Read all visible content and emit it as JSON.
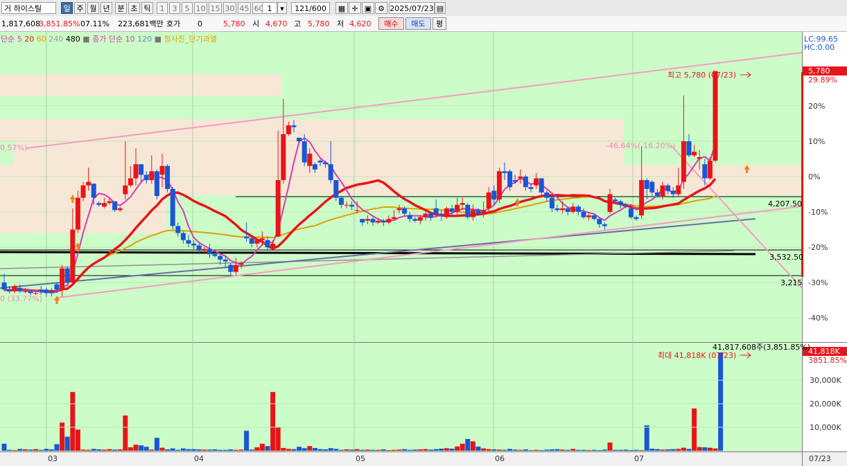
{
  "toolbar": {
    "stock_name": "거 하이스틸",
    "period_tabs": [
      "일",
      "주",
      "월",
      "년",
      "분",
      "초",
      "틱"
    ],
    "selected_period": "일",
    "intervals": [
      "1",
      "3",
      "5",
      "10",
      "15",
      "30",
      "45",
      "60"
    ],
    "interval_value": "1",
    "count_value": "121",
    "count_total": "/600",
    "date_value": "2025/07/23"
  },
  "info_bar": {
    "volume": "1,817,608",
    "volume_ratio": "3,851.85%",
    "turnover": "07.11%",
    "amount": "223,681백만",
    "quote_label": "호가",
    "quote_value": "0",
    "current_price": "5,780",
    "open_label": "시",
    "open_value": "4,670",
    "high_label": "고",
    "high_value": "5,780",
    "low_label": "저",
    "low_value": "4,620",
    "buy_button": "매수",
    "sell_button": "매도",
    "eval_button": "평"
  },
  "legend": {
    "price_ma_label": "단순",
    "price_ma_periods": [
      "5",
      "20",
      "60",
      "240",
      "480"
    ],
    "price_ma_colors": [
      "#e8141a",
      "#e8141a",
      "#e0a000",
      "#9a9a9a",
      "#000000"
    ],
    "volume_ma_label": "종가 단순",
    "volume_ma_periods": [
      "10",
      "120"
    ],
    "signal_label": "청사진_단기과열",
    "lc_label": "LC:99.65",
    "hc_label": "HC:0.00"
  },
  "annotations": {
    "high_marker": "최고 5,780 (07/23)",
    "max_volume_marker": "최대 41,818K (07/23)",
    "decline_label": "-46.64%(-16.20%)",
    "left_pct_label": "0.57%)",
    "bottom_left_label": "0 (33.77%)",
    "volume_total_label": "41,817,608주(3,851.85%)"
  },
  "price_axis": {
    "current_box": "5,780",
    "current_pct": "29.89%",
    "pct_ticks": [
      "20%",
      "10%",
      "0%",
      "-10%",
      "-20%",
      "-30%",
      "-40%"
    ],
    "level_labels": [
      "4,207.50",
      "3,532.50",
      "3,215"
    ]
  },
  "volume_axis": {
    "current_box": "41,818K",
    "current_pct": "3851.85%",
    "ticks": [
      "30,000K",
      "20,000K",
      "10,000K"
    ]
  },
  "x_axis": {
    "month_labels": [
      "03",
      "04",
      "05",
      "06",
      "07"
    ],
    "end_label": "07/23"
  },
  "colors": {
    "chart_bg": "#ccfcc8",
    "up_candle": "#e8141a",
    "down_candle": "#1a56d6",
    "ma5": "#d63ab4",
    "ma20": "#e8141a",
    "ma60": "#e0a000",
    "channel": "#f79ac0",
    "resistance_zone": "#f7e7d6"
  },
  "chart_data": {
    "type": "candlestick",
    "period": "daily",
    "months_shown": [
      "03",
      "04",
      "05",
      "06",
      "07"
    ],
    "last_date": "2025/07/23",
    "last_candle": {
      "open": 4670,
      "high": 5780,
      "low": 4620,
      "close": 5780
    },
    "highest": {
      "price": 5780,
      "date": "07/23"
    },
    "support_levels": [
      4207.5,
      3532.5,
      3215
    ],
    "candles_pct": [
      [
        -30,
        -32,
        -32.5,
        -27.5
      ],
      [
        -32,
        -32.5,
        -33,
        -31
      ],
      [
        -32.5,
        -31,
        -33,
        -30.5
      ],
      [
        -31.5,
        -32.5,
        -33,
        -30.5
      ],
      [
        -32.5,
        -32.5,
        -33,
        -31.5
      ],
      [
        -32.5,
        -33,
        -33.5,
        -32
      ],
      [
        -33,
        -33,
        -33.5,
        -32.5
      ],
      [
        -32,
        -32.5,
        -33.5,
        -31
      ],
      [
        -32,
        -33,
        -34,
        -31.5
      ],
      [
        -32.5,
        -33,
        -34,
        -31.5
      ],
      [
        -30.5,
        -32,
        -33,
        -30
      ],
      [
        -32,
        -26,
        -34,
        -25
      ],
      [
        -26,
        -30,
        -31,
        -25.5
      ],
      [
        -30,
        -15,
        -31,
        -9
      ],
      [
        -15,
        -6,
        -16,
        -4
      ],
      [
        -6,
        -2.5,
        -7,
        -1.5
      ],
      [
        -2.5,
        -1.5,
        -4,
        2.5
      ],
      [
        -2,
        -6,
        -8,
        -2
      ],
      [
        -7.5,
        -8,
        -8.5,
        -7
      ],
      [
        -8.5,
        -7.5,
        -9,
        -6
      ],
      [
        -7.5,
        -7,
        -8,
        -6
      ],
      [
        -7,
        -9.5,
        -10,
        -7
      ],
      [
        -9.5,
        -9,
        -10,
        -8.5
      ],
      [
        -5,
        -2.5,
        -6.5,
        10
      ],
      [
        -2.5,
        -0.5,
        -3,
        3
      ],
      [
        -0.5,
        3.5,
        -2.5,
        8
      ],
      [
        3.5,
        0.5,
        -1.5,
        2.5
      ],
      [
        0.5,
        -1,
        -2,
        1.5
      ],
      [
        -1,
        1.5,
        -2,
        6
      ],
      [
        1.5,
        -5.5,
        -6.5,
        2
      ],
      [
        0.5,
        3,
        -3,
        6.5
      ],
      [
        3,
        -3.5,
        -4.5,
        3.5
      ],
      [
        -3.5,
        -14,
        -15,
        -3
      ],
      [
        -14,
        -16,
        -17,
        -13
      ],
      [
        -16,
        -18,
        -19,
        -15.5
      ],
      [
        -18,
        -19,
        -20,
        -16.5
      ],
      [
        -19,
        -19.5,
        -20.5,
        -18
      ],
      [
        -19.5,
        -21,
        -22,
        -19
      ],
      [
        -21,
        -20.5,
        -22,
        -20
      ],
      [
        -20.5,
        -22,
        -23,
        -19
      ],
      [
        -22,
        -22.5,
        -23,
        -21
      ],
      [
        -22.5,
        -23.5,
        -25,
        -22
      ],
      [
        -23.5,
        -24,
        -26,
        -22.5
      ],
      [
        -25,
        -27,
        -28,
        -24.5
      ],
      [
        -27,
        -25,
        -28,
        -23
      ],
      [
        -25,
        -24.5,
        -26,
        -24
      ],
      [
        -17,
        -17.5,
        -18.5,
        -13
      ],
      [
        -17.5,
        -19,
        -20,
        -17
      ],
      [
        -19,
        -18,
        -20,
        -17.5
      ],
      [
        -18,
        -17.5,
        -19.5,
        -15.5
      ],
      [
        -18,
        -20,
        -21,
        -17
      ],
      [
        -20,
        -19,
        -21,
        -18
      ],
      [
        -17,
        -1,
        -3,
        13
      ],
      [
        -1,
        12,
        -2,
        22
      ],
      [
        12,
        14.5,
        11.5,
        15.5
      ],
      [
        14.5,
        14,
        12.5,
        16
      ],
      [
        11,
        10,
        9.5,
        11
      ],
      [
        10,
        4,
        3,
        12
      ],
      [
        3,
        6.5,
        1,
        8
      ],
      [
        3.5,
        2,
        1,
        4
      ],
      [
        4.5,
        4,
        3,
        5
      ],
      [
        4,
        3.5,
        2.5,
        4.5
      ],
      [
        3.5,
        -1,
        -2,
        10
      ],
      [
        -1,
        -6,
        -7,
        -2
      ],
      [
        -6,
        -8,
        -9,
        -5.5
      ],
      [
        -8,
        -8,
        -9,
        -7
      ],
      [
        -8,
        -8.5,
        -9.5,
        -7
      ],
      [
        -9.5,
        -9.5,
        -10.5,
        -7
      ],
      [
        -12,
        -13,
        -14,
        -12
      ],
      [
        -12.5,
        -12,
        -13.5,
        -11
      ],
      [
        -12,
        -13,
        -14,
        -11.5
      ],
      [
        -13,
        -12.5,
        -13.5,
        -12
      ],
      [
        -12.5,
        -13,
        -14,
        -12
      ],
      [
        -13,
        -12,
        -13.5,
        -11
      ],
      [
        -12,
        -11.5,
        -12.5,
        -9.5
      ],
      [
        -9.5,
        -9,
        -10.5,
        -8
      ],
      [
        -9,
        -10.5,
        -11,
        -8.5
      ],
      [
        -11,
        -12,
        -13,
        -10
      ],
      [
        -12,
        -12.5,
        -13,
        -11.5
      ],
      [
        -12.5,
        -11.5,
        -13.5,
        -11
      ],
      [
        -11.5,
        -10.5,
        -12.5,
        -10
      ],
      [
        -10.5,
        -11.5,
        -12.5,
        -10
      ],
      [
        -9,
        -10.5,
        -11,
        -6.5
      ],
      [
        -10.5,
        -11,
        -12.5,
        -9.5
      ],
      [
        -11.5,
        -9,
        -12,
        -8.5
      ],
      [
        -9,
        -10,
        -11,
        -8
      ],
      [
        -10,
        -8,
        -11,
        -6
      ],
      [
        -8,
        -7.5,
        -9.5,
        -6
      ],
      [
        -8,
        -11.5,
        -12,
        -7.5
      ],
      [
        -11.5,
        -9.5,
        -12.5,
        -8
      ],
      [
        -9.5,
        -10.5,
        -11,
        -9
      ],
      [
        -10.5,
        -9.5,
        -11.5,
        -7
      ],
      [
        -9,
        -4.5,
        -10,
        -3
      ],
      [
        -4,
        -6.5,
        -8,
        -2.5
      ],
      [
        -6.5,
        1.5,
        -7.5,
        2.5
      ],
      [
        1.5,
        1,
        -1,
        4
      ],
      [
        1.5,
        -3,
        -4,
        2
      ],
      [
        -1,
        -1.5,
        -2,
        0.5
      ],
      [
        -0.5,
        0,
        -2,
        2
      ],
      [
        0,
        -3,
        -4,
        0.5
      ],
      [
        -3,
        -3.5,
        -4.5,
        -2
      ],
      [
        -2.5,
        -0.5,
        -3.5,
        1
      ],
      [
        -0.5,
        -4.5,
        -5.5,
        -0.5
      ],
      [
        -4.5,
        -6,
        -7,
        -4
      ],
      [
        -6,
        -9,
        -10,
        -5.5
      ],
      [
        -9,
        -9.5,
        -10,
        -8
      ],
      [
        -9.5,
        -9,
        -10.5,
        -7
      ],
      [
        -9,
        -10,
        -11,
        -8.5
      ],
      [
        -10,
        -8.5,
        -10.5,
        -7.5
      ],
      [
        -8.5,
        -10,
        -11,
        -8
      ],
      [
        -10,
        -11.5,
        -12,
        -9
      ],
      [
        -11.5,
        -11,
        -12.5,
        -10.5
      ],
      [
        -11,
        -12,
        -12.5,
        -10.5
      ],
      [
        -12,
        -13.5,
        -14.5,
        -11.5
      ],
      [
        -13.5,
        -14,
        -15,
        -13
      ],
      [
        -10,
        -5,
        -10.5,
        -3.5
      ],
      [
        -6.5,
        -7,
        -7.5,
        -6
      ],
      [
        -7,
        -8,
        -9,
        -6.5
      ],
      [
        -8,
        -8.5,
        -9,
        -7.5
      ],
      [
        -9,
        -11.5,
        -12,
        -8.5
      ],
      [
        -11.5,
        -12,
        -12.5,
        -11
      ],
      [
        -11,
        -1,
        -12,
        8.5
      ],
      [
        -1,
        -3.5,
        -6.5,
        -0.5
      ],
      [
        -1.5,
        -4.5,
        -5.5,
        -1
      ],
      [
        -4.5,
        -5.5,
        -6,
        -3.5
      ],
      [
        -5.5,
        -2.5,
        -6.5,
        -1.5
      ],
      [
        -2.5,
        -4,
        -5,
        -2
      ],
      [
        -4,
        -5,
        -6,
        -3
      ],
      [
        -5,
        -2.5,
        -5.5,
        2.5
      ],
      [
        -1.5,
        10,
        -3.5,
        23
      ],
      [
        10,
        6,
        5.5,
        12
      ],
      [
        6,
        7,
        5.5,
        9
      ],
      [
        5,
        5.5,
        2,
        7.5
      ],
      [
        3.5,
        -0.5,
        -2.5,
        5
      ],
      [
        -0.5,
        4.5,
        -1,
        5.5
      ],
      [
        4.5,
        29.89,
        4,
        29.89
      ]
    ],
    "volume_k": [
      3000,
      400,
      300,
      800,
      600,
      500,
      700,
      400,
      800,
      600,
      2800,
      12000,
      6000,
      25000,
      9000,
      500,
      400,
      800,
      600,
      500,
      700,
      500,
      600,
      15000,
      1500,
      2600,
      2300,
      1700,
      500,
      5500,
      1300,
      600,
      1000,
      400,
      1000,
      700,
      700,
      600,
      500,
      500,
      600,
      400,
      400,
      600,
      400,
      500,
      8500,
      500,
      1500,
      3000,
      2000,
      25000,
      10000,
      1200,
      800,
      700,
      1700,
      1100,
      2000,
      1200,
      700,
      600,
      1100,
      800,
      400,
      600,
      500,
      700,
      400,
      500,
      400,
      400,
      600,
      300,
      400,
      500,
      700,
      400,
      500,
      600,
      700,
      500,
      700,
      900,
      1100,
      900,
      1800,
      3000,
      5000,
      4000,
      1800,
      1000,
      700,
      600,
      500,
      400,
      800,
      500,
      400,
      600,
      300,
      400,
      300,
      500,
      600,
      700,
      500,
      400,
      800,
      400,
      400,
      300,
      400,
      300,
      500,
      3500,
      400,
      400,
      500,
      300,
      400,
      300,
      10800,
      900,
      700,
      500,
      600,
      700,
      800,
      1300,
      800,
      18000,
      1600,
      1500,
      1300,
      1000,
      41818
    ]
  }
}
